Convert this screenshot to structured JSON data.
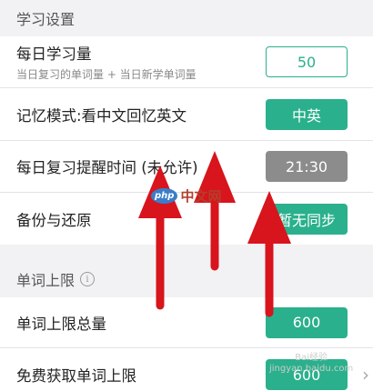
{
  "section_study": {
    "title": "学习设置"
  },
  "daily_amount": {
    "title": "每日学习量",
    "subtitle": "当日复习的单词量 + 当日新学单词量",
    "value": "50"
  },
  "memory_mode": {
    "title": "记忆模式:看中文回忆英文",
    "value": "中英"
  },
  "review_reminder": {
    "title": "每日复习提醒时间 (未允许)",
    "value": "21:30"
  },
  "backup": {
    "title": "备份与还原",
    "value": "暂无同步"
  },
  "section_limit": {
    "title": "单词上限",
    "info_icon": "info-icon"
  },
  "limit_total": {
    "title": "单词上限总量",
    "value": "600"
  },
  "free_limit": {
    "title": "免费获取单词上限",
    "value": "600",
    "chevron": "›"
  },
  "watermark": {
    "brand": "php",
    "text": "中文网"
  },
  "watermark2": {
    "line1": "Bai经验",
    "line2": "jingyan.baidu.com"
  },
  "colors": {
    "accent": "#2ab08c",
    "disabled": "#8c8c8c",
    "arrow": "#d8141c",
    "background": "#f2f2f4"
  }
}
